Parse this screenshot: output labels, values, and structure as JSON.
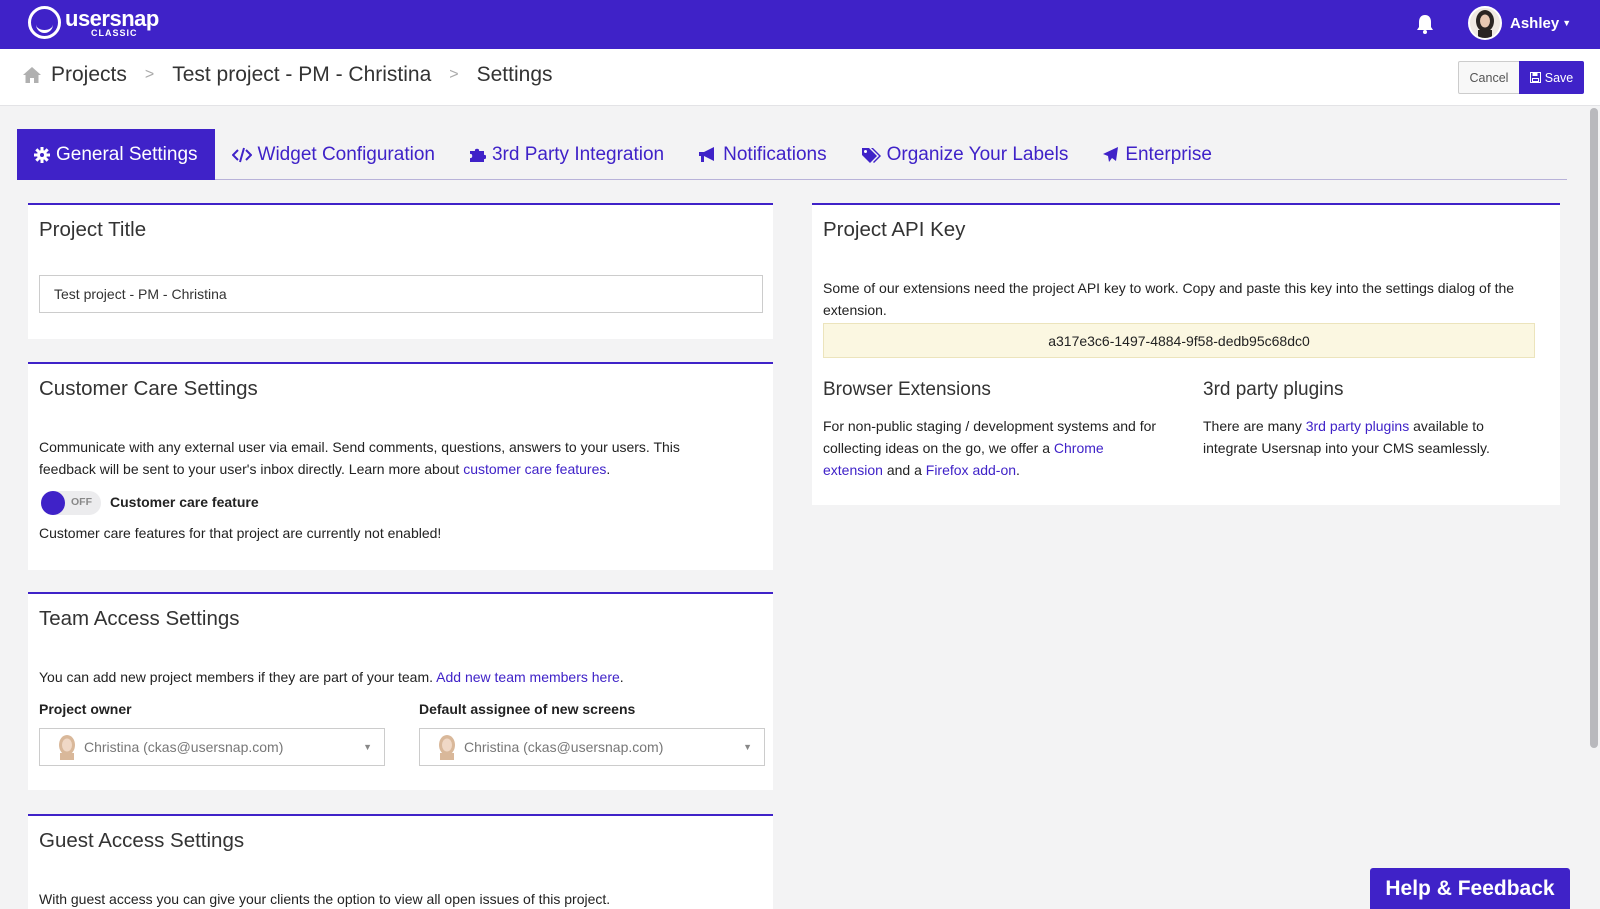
{
  "app": {
    "logo_name": "usersnap",
    "logo_sub": "CLASSIC",
    "user_name": "Ashley"
  },
  "colors": {
    "brand": "#3f22c8",
    "apikey_bg": "#fbf7e1"
  },
  "icons": [
    "bell-icon",
    "home-icon",
    "save-icon",
    "gear-icon",
    "code-icon",
    "puzzle-icon",
    "bullhorn-icon",
    "tags-icon",
    "plane-icon"
  ],
  "breadcrumb": {
    "items": [
      "Projects",
      "Test project - PM - Christina",
      "Settings"
    ],
    "separator": ">"
  },
  "actions": {
    "cancel": "Cancel",
    "save": "Save"
  },
  "tabs": [
    {
      "label": "General Settings",
      "active": true
    },
    {
      "label": "Widget Configuration",
      "active": false
    },
    {
      "label": "3rd Party Integration",
      "active": false
    },
    {
      "label": "Notifications",
      "active": false
    },
    {
      "label": "Organize Your Labels",
      "active": false
    },
    {
      "label": "Enterprise",
      "active": false
    }
  ],
  "project_title": {
    "heading": "Project Title",
    "value": "Test project - PM - Christina"
  },
  "customer_care": {
    "heading": "Customer Care Settings",
    "description": "Communicate with any external user via email. Send comments, questions, answers to your users. This feedback will be sent to your user's inbox directly. Learn more about ",
    "link": "customer care features",
    "after_link": ".",
    "toggle_state": "OFF",
    "toggle_label": "Customer care feature",
    "status": "Customer care features for that project are currently not enabled!"
  },
  "team_access": {
    "heading": "Team Access Settings",
    "description": "You can add new project members if they are part of your team. ",
    "link": "Add new team members here",
    "after_link": ".",
    "owner_label": "Project owner",
    "owner_value": "Christina (ckas@usersnap.com)",
    "assignee_label": "Default assignee of new screens",
    "assignee_value": "Christina (ckas@usersnap.com)"
  },
  "guest_access": {
    "heading": "Guest Access Settings",
    "description": "With guest access you can give your clients the option to view all open issues of this project."
  },
  "api_key": {
    "heading": "Project API Key",
    "description": "Some of our extensions need the project API key to work. Copy and paste this key into the settings dialog of the extension.",
    "value": "a317e3c6-1497-4884-9f58-dedb95c68dc0"
  },
  "browser_ext": {
    "heading": "Browser Extensions",
    "text1": "For non-public staging / development systems and for collecting ideas on the go, we offer a ",
    "link1": "Chrome extension",
    "text2": " and a ",
    "link2": "Firefox add-on",
    "text3": "."
  },
  "plugins": {
    "heading": "3rd party plugins",
    "text1": "There are many ",
    "link": "3rd party plugins",
    "text2": " available to integrate Usersnap into your CMS seamlessly."
  },
  "help_button": "Help & Feedback"
}
